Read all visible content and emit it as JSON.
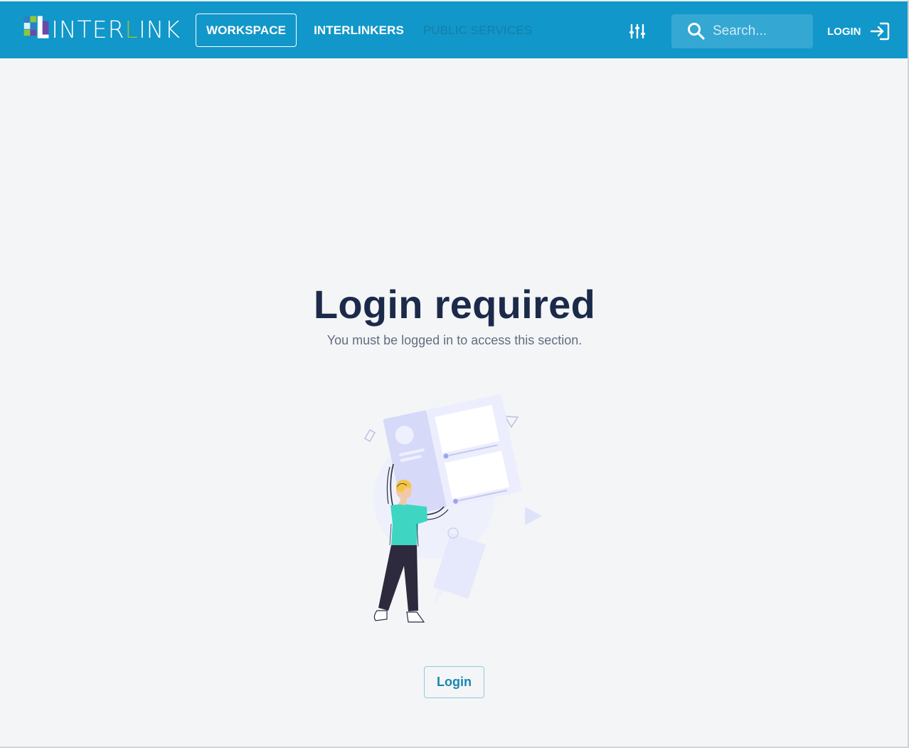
{
  "brand": {
    "logo_text_a": "INTER",
    "logo_text_b": "L",
    "logo_text_c": "INK",
    "colors": {
      "navbar": "#1197c9",
      "accent_green": "#8dc63f",
      "logo_purple": "#6a4aa8",
      "logo_blue": "#2f7fc7"
    }
  },
  "nav": {
    "items": [
      {
        "label": "WORKSPACE",
        "active": true
      },
      {
        "label": "INTERLINKERS",
        "active": false
      },
      {
        "label": "PUBLIC SERVICES",
        "active": false,
        "disabled": true
      }
    ],
    "filter_icon": "sliders-icon"
  },
  "search": {
    "placeholder": "Search...",
    "value": "",
    "icon": "search-icon"
  },
  "auth": {
    "login_label": "LOGIN",
    "login_icon": "login-arrow-icon"
  },
  "main": {
    "title": "Login required",
    "subtitle": "You must be logged in to access this section.",
    "button_label": "Login",
    "illustration": "person-holding-document-illustration"
  }
}
